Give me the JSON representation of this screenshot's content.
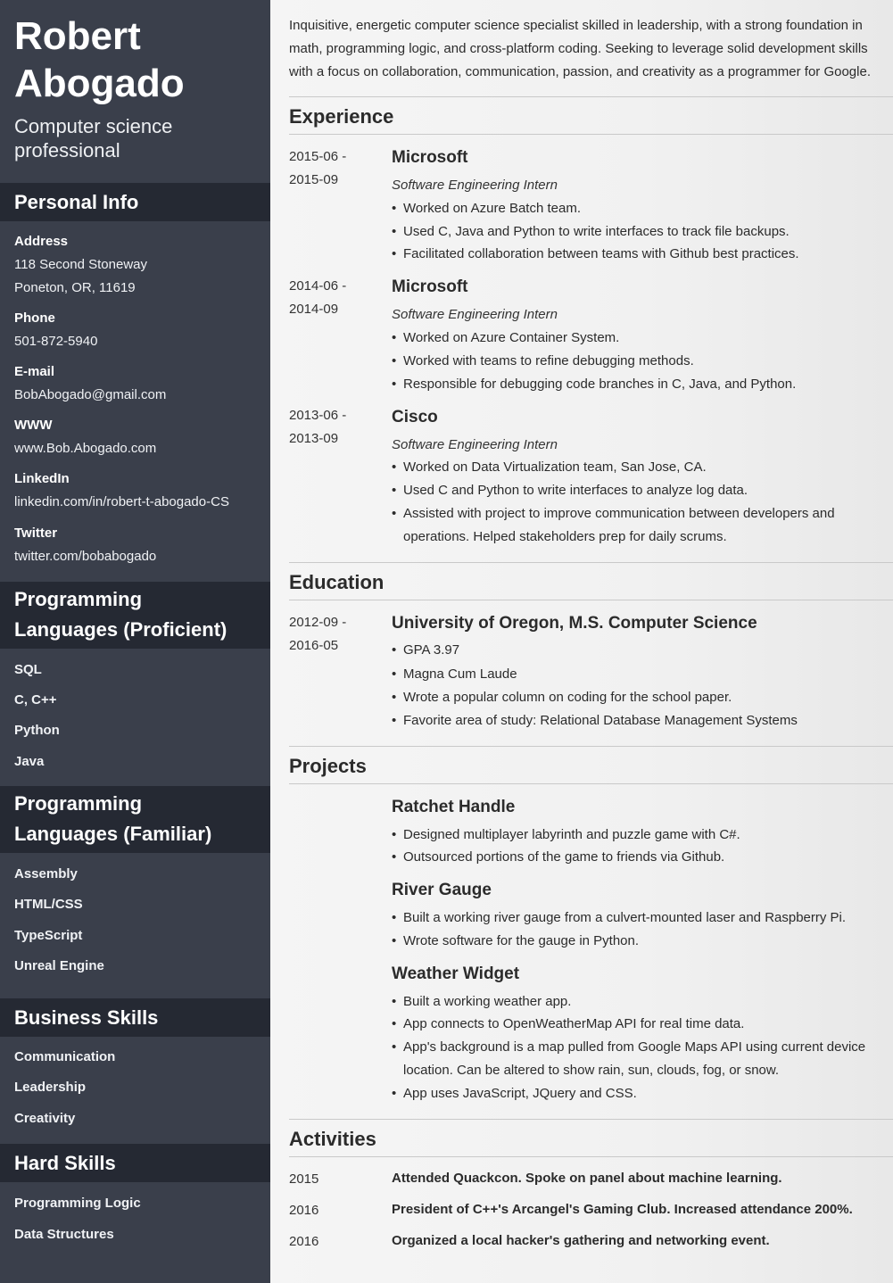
{
  "person": {
    "first_name": "Robert",
    "last_name": "Abogado",
    "title_line1": "Computer science",
    "title_line2": "professional"
  },
  "sidebar": {
    "personal_info_heading": "Personal Info",
    "address_label": "Address",
    "address_line1": "118 Second Stoneway",
    "address_line2": "Poneton, OR, 11619",
    "phone_label": "Phone",
    "phone": "501-872-5940",
    "email_label": "E-mail",
    "email": "BobAbogado@gmail.com",
    "www_label": "WWW",
    "www": "www.Bob.Abogado.com",
    "linkedin_label": "LinkedIn",
    "linkedin": "linkedin.com/in/robert-t-abogado-CS",
    "twitter_label": "Twitter",
    "twitter": "twitter.com/bobabogado",
    "proficient_heading_line1": "Programming",
    "proficient_heading_line2": "Languages (Proficient)",
    "proficient": [
      "SQL",
      "C, C++",
      "Python",
      "Java"
    ],
    "familiar_heading_line1": "Programming",
    "familiar_heading_line2": "Languages (Familiar)",
    "familiar": [
      "Assembly",
      "HTML/CSS",
      "TypeScript",
      "Unreal Engine"
    ],
    "business_heading": "Business Skills",
    "business": [
      "Communication",
      "Leadership",
      "Creativity"
    ],
    "hard_heading": "Hard Skills",
    "hard": [
      "Programming Logic",
      "Data Structures"
    ]
  },
  "summary": {
    "line1": "Inquisitive, energetic computer science specialist skilled in leadership, with a strong foundation in",
    "line2": "math, programming logic, and cross-platform coding. Seeking to leverage solid development skills",
    "line3": "with a focus on collaboration, communication, passion, and creativity as a programmer for Google."
  },
  "experience": {
    "heading": "Experience",
    "jobs": [
      {
        "date_start": "2015-06 -",
        "date_end": "2015-09",
        "company": "Microsoft",
        "role": "Software Engineering Intern",
        "bullets": [
          "Worked on Azure Batch team.",
          "Used C, Java and Python to write interfaces to track file backups.",
          "Facilitated collaboration between teams with Github best practices."
        ]
      },
      {
        "date_start": "2014-06 -",
        "date_end": "2014-09",
        "company": "Microsoft",
        "role": "Software Engineering Intern",
        "bullets": [
          "Worked on Azure Container System.",
          "Worked with teams to refine debugging methods.",
          "Responsible for debugging code branches in C, Java, and Python."
        ]
      },
      {
        "date_start": "2013-06 -",
        "date_end": "2013-09",
        "company": "Cisco",
        "role": "Software Engineering Intern",
        "bullets": [
          "Worked on Data Virtualization team, San Jose, CA.",
          "Used C and Python to write interfaces to analyze log data.",
          "Assisted with project to improve communication between developers and operations. Helped stakeholders prep for daily scrums."
        ]
      }
    ]
  },
  "education": {
    "heading": "Education",
    "date_start": "2012-09 -",
    "date_end": "2016-05",
    "school": "University of Oregon, M.S. Computer Science",
    "bullets": [
      "GPA 3.97",
      "Magna Cum Laude",
      "Wrote a popular column on coding for the school paper.",
      "Favorite area of study: Relational Database Management Systems"
    ]
  },
  "projects": {
    "heading": "Projects",
    "items": [
      {
        "name": "Ratchet Handle",
        "bullets": [
          "Designed multiplayer labyrinth and puzzle game with C#.",
          "Outsourced portions of the game to friends via Github."
        ]
      },
      {
        "name": "River Gauge",
        "bullets": [
          "Built a working river gauge from a culvert-mounted laser and Raspberry Pi.",
          "Wrote software for the gauge in Python."
        ]
      },
      {
        "name": "Weather Widget",
        "bullets": [
          "Built a working weather app.",
          "App connects to OpenWeatherMap API for real time data.",
          "App's background is a map pulled from Google Maps API using current device location. Can be altered to show rain, sun, clouds, fog, or snow.",
          "App uses JavaScript, JQuery and CSS."
        ]
      }
    ]
  },
  "activities": {
    "heading": "Activities",
    "items": [
      {
        "year": "2015",
        "text": "Attended Quackcon. Spoke on panel about machine learning."
      },
      {
        "year": "2016",
        "text": "President of C++'s Arcangel's Gaming Club. Increased attendance 200%."
      },
      {
        "year": "2016",
        "text": "Organized a local hacker's gathering and networking event."
      }
    ]
  },
  "bullet_char": "•"
}
